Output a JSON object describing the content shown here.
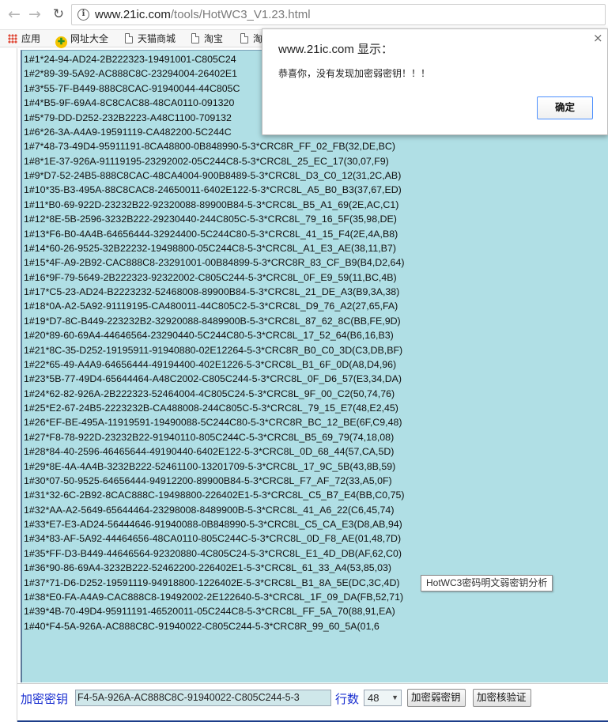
{
  "browser": {
    "url_host": "www.21ic.com",
    "url_path": "/tools/HotWC3_V1.23.html"
  },
  "bookmarks": [
    {
      "label": "应用",
      "icon": "apps-grid-icon"
    },
    {
      "label": "网址大全",
      "icon": "hao123-icon"
    },
    {
      "label": "天猫商城",
      "icon": "page-icon"
    },
    {
      "label": "淘宝",
      "icon": "page-icon"
    },
    {
      "label": "淘",
      "icon": "page-icon"
    }
  ],
  "results": [
    "1#1*24-94-AD24-2B222323-19491001-C805C24",
    "1#2*89-39-5A92-AC888C8C-23294004-26402E1",
    "1#3*55-7F-B449-888C8CAC-91940044-44C805C",
    "1#4*B5-9F-69A4-8C8CAC88-48CA0110-091320",
    "1#5*79-DD-D252-232B2223-A48C1100-709132",
    "1#6*26-3A-A4A9-19591119-CA482200-5C244C",
    "1#7*48-73-49D4-95911191-8CA48800-0B848990-5-3*CRC8R_FF_02_FB(32,DE,BC)",
    "1#8*1E-37-926A-91119195-23292002-05C244C8-5-3*CRC8L_25_EC_17(30,07,F9)",
    "1#9*D7-52-24B5-888C8CAC-48CA4004-900B8489-5-3*CRC8L_D3_C0_12(31,2C,AB)",
    "1#10*35-B3-495A-88C8CAC8-24650011-6402E122-5-3*CRC8L_A5_B0_B3(37,67,ED)",
    "1#11*B0-69-922D-23232B22-92320088-89900B84-5-3*CRC8L_B5_A1_69(2E,AC,C1)",
    "1#12*8E-5B-2596-3232B222-29230440-244C805C-5-3*CRC8L_79_16_5F(35,98,DE)",
    "1#13*F6-B0-4A4B-64656444-32924400-5C244C80-5-3*CRC8L_41_15_F4(2E,4A,B8)",
    "1#14*60-26-9525-32B22232-19498800-05C244C8-5-3*CRC8L_A1_E3_AE(38,11,B7)",
    "1#15*4F-A9-2B92-CAC888C8-23291001-00B84899-5-3*CRC8R_83_CF_B9(B4,D2,64)",
    "1#16*9F-79-5649-2B222323-92322002-C805C244-5-3*CRC8L_0F_E9_59(11,BC,4B)",
    "1#17*C5-23-AD24-B2223232-52468008-89900B84-5-3*CRC8L_21_DE_A3(B9,3A,38)",
    "1#18*0A-A2-5A92-91119195-CA480011-44C805C2-5-3*CRC8L_D9_76_A2(27,65,FA)",
    "1#19*D7-8C-B449-223232B2-32920088-8489900B-5-3*CRC8L_87_62_8C(BB,FE,9D)",
    "1#20*89-60-69A4-44646564-23290440-5C244C80-5-3*CRC8L_17_52_64(B6,16,B3)",
    "1#21*8C-35-D252-19195911-91940880-02E12264-5-3*CRC8R_B0_C0_3D(C3,DB,BF)",
    "1#22*65-49-A4A9-64656444-49194400-402E1226-5-3*CRC8L_B1_6F_0D(A8,D4,96)",
    "1#23*5B-77-49D4-65644464-A48C2002-C805C244-5-3*CRC8L_0F_D6_57(E3,34,DA)",
    "1#24*62-82-926A-2B222323-52464004-4C805C24-5-3*CRC8L_9F_00_C2(50,74,76)",
    "1#25*E2-67-24B5-2223232B-CA488008-244C805C-5-3*CRC8L_79_15_E7(48,E2,45)",
    "1#26*EF-BE-495A-11919591-19490088-5C244C80-5-3*CRC8R_BC_12_BE(6F,C9,48)",
    "1#27*F8-78-922D-23232B22-91940110-805C244C-5-3*CRC8L_B5_69_79(74,18,08)",
    "1#28*84-40-2596-46465644-49190440-6402E122-5-3*CRC8L_0D_68_44(57,CA,5D)",
    "1#29*8E-4A-4A4B-3232B222-52461100-13201709-5-3*CRC8L_17_9C_5B(43,8B,59)",
    "1#30*07-50-9525-64656444-94912200-89900B84-5-3*CRC8L_F7_AF_72(33,A5,0F)",
    "1#31*32-6C-2B92-8CAC888C-19498800-226402E1-5-3*CRC8L_C5_B7_E4(BB,C0,75)",
    "1#32*AA-A2-5649-65644464-23298008-8489900B-5-3*CRC8L_41_A6_22(C6,45,74)",
    "1#33*E7-E3-AD24-56444646-91940088-0B848990-5-3*CRC8L_C5_CA_E3(D8,AB,94)",
    "1#34*83-AF-5A92-44464656-48CA0110-805C244C-5-3*CRC8L_0D_F8_AE(01,48,7D)",
    "1#35*FF-D3-B449-44646564-92320880-4C805C24-5-3*CRC8L_E1_4D_DB(AF,62,C0)",
    "1#36*90-86-69A4-3232B222-52462200-226402E1-5-3*CRC8L_61_33_A4(53,85,03)",
    "1#37*71-D6-D252-19591119-94918800-1226402E-5-3*CRC8L_B1_8A_5E(DC,3C,4D)",
    "1#38*E0-FA-A4A9-CAC888C8-19492002-2E122640-5-3*CRC8L_1F_09_DA(FB,52,71)",
    "1#39*4B-70-49D4-95911191-46520011-05C244C8-5-3*CRC8L_FF_5A_70(88,91,EA)",
    "1#40*F4-5A-926A-AC888C8C-91940022-C805C244-5-3*CRC8R_99_60_5A(01,6"
  ],
  "tooltip": "HotWC3密码明文弱密钥分析",
  "controls": {
    "key_label": "加密密钥",
    "key_value": "F4-5A-926A-AC888C8C-91940022-C805C244-5-3",
    "rows_label": "行数",
    "rows_value": "48",
    "weak_key_button": "加密弱密钥",
    "verify_button": "加密核验证"
  },
  "dialog": {
    "title": "www.21ic.com 显示：",
    "message": "恭喜你，没有发现加密弱密钥！！！",
    "ok_label": "确定",
    "close_glyph": "×"
  },
  "colors": {
    "output_bg": "#b0dfe5",
    "label_blue": "#1a2fd0",
    "dialog_ok_border": "#4d90fe"
  }
}
